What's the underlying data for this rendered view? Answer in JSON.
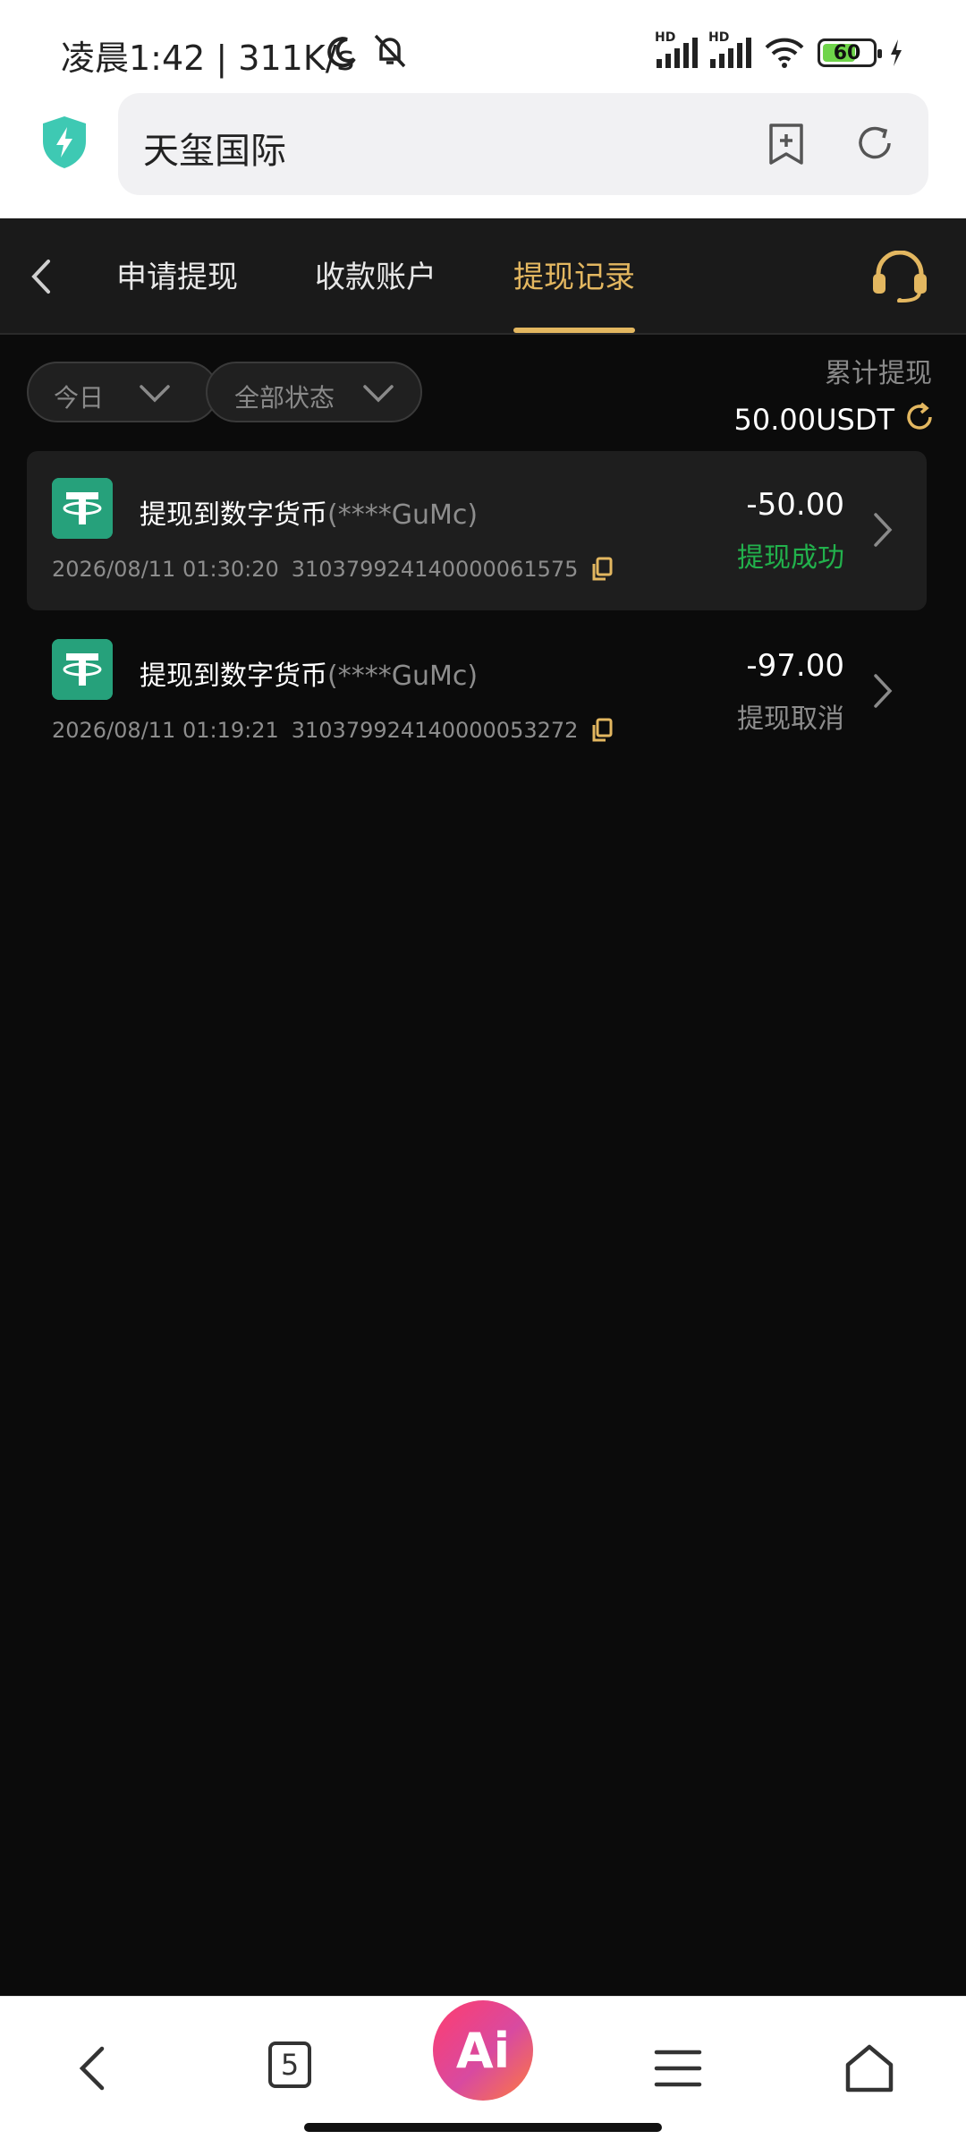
{
  "status_bar": {
    "time": "凌晨1:42 | 311K/s",
    "battery_level": "60",
    "hd_label": "HD"
  },
  "browser": {
    "site_title": "天玺国际",
    "open_tabs_count": "5",
    "ai_label": "Ai"
  },
  "header": {
    "tabs": [
      {
        "label": "申请提现"
      },
      {
        "label": "收款账户"
      },
      {
        "label": "提现记录"
      }
    ]
  },
  "filters": {
    "date": "今日",
    "status": "全部状态"
  },
  "summary": {
    "label": "累计提现",
    "value": "50.00USDT"
  },
  "records": [
    {
      "title": "提现到数字货币",
      "account_mask": "(****GuMc)",
      "datetime": "2026/08/11 01:30:20",
      "order_id": "310379924140000061575",
      "amount": "-50.00",
      "status": "提现成功",
      "status_color": "#22b14c"
    },
    {
      "title": "提现到数字货币",
      "account_mask": "(****GuMc)",
      "datetime": "2026/08/11 01:19:21",
      "order_id": "310379924140000053272",
      "amount": "-97.00",
      "status": "提现取消",
      "status_color": "#8d8d8d"
    }
  ],
  "colors": {
    "accent": "#e3b760",
    "tether": "#26a17b",
    "background": "#0b0b0b"
  },
  "icons": {
    "back": "chevron-left-icon",
    "support": "headset-icon",
    "refresh": "refresh-icon",
    "copy": "copy-icon",
    "row_arrow": "chevron-right-icon",
    "bookmark": "add-bookmark-icon",
    "reload": "reload-icon",
    "shield": "shield-bolt-icon"
  }
}
